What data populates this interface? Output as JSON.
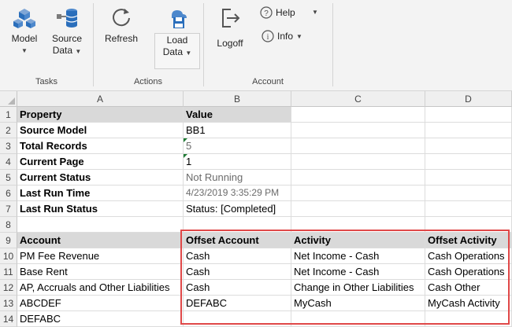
{
  "ribbon": {
    "groups": {
      "tasks": "Tasks",
      "actions": "Actions",
      "account": "Account"
    },
    "buttons": {
      "model": "Model",
      "source_data_1": "Source",
      "source_data_2": "Data",
      "refresh": "Refresh",
      "load_data_1": "Load",
      "load_data_2": "Data",
      "logoff": "Logoff",
      "help": "Help",
      "info": "Info"
    }
  },
  "grid": {
    "columns": [
      "A",
      "B",
      "C",
      "D"
    ],
    "rows": [
      "1",
      "2",
      "3",
      "4",
      "5",
      "6",
      "7",
      "8",
      "9",
      "10",
      "11",
      "12",
      "13",
      "14"
    ],
    "properties": {
      "header_property": "Property",
      "header_value": "Value",
      "items": [
        {
          "label": "Source Model",
          "value": "BB1"
        },
        {
          "label": "Total Records",
          "value": "5"
        },
        {
          "label": "Current Page",
          "value": "1"
        },
        {
          "label": "Current Status",
          "value": "Not Running"
        },
        {
          "label": "Last Run Time",
          "value": "4/23/2019 3:35:29 PM"
        },
        {
          "label": "Last Run Status",
          "value": "Status: [Completed]"
        }
      ]
    },
    "mapping": {
      "headers": [
        "Account",
        "Offset Account",
        "Activity",
        "Offset Activity"
      ],
      "rows": [
        [
          "PM Fee Revenue",
          "Cash",
          "Net Income - Cash",
          "Cash Operations"
        ],
        [
          "Base Rent",
          "Cash",
          "Net Income - Cash",
          "Cash Operations"
        ],
        [
          "AP, Accruals and Other Liabilities",
          "Cash",
          "Change in Other Liabilities",
          "Cash Other"
        ],
        [
          "ABCDEF",
          "DEFABC",
          "MyCash",
          "MyCash Activity"
        ],
        [
          "DEFABC",
          "",
          "",
          ""
        ]
      ]
    }
  },
  "colors": {
    "highlight_border": "#e04848",
    "header_fill": "#d9d9d9",
    "icon_blue": "#2a6ebb"
  }
}
